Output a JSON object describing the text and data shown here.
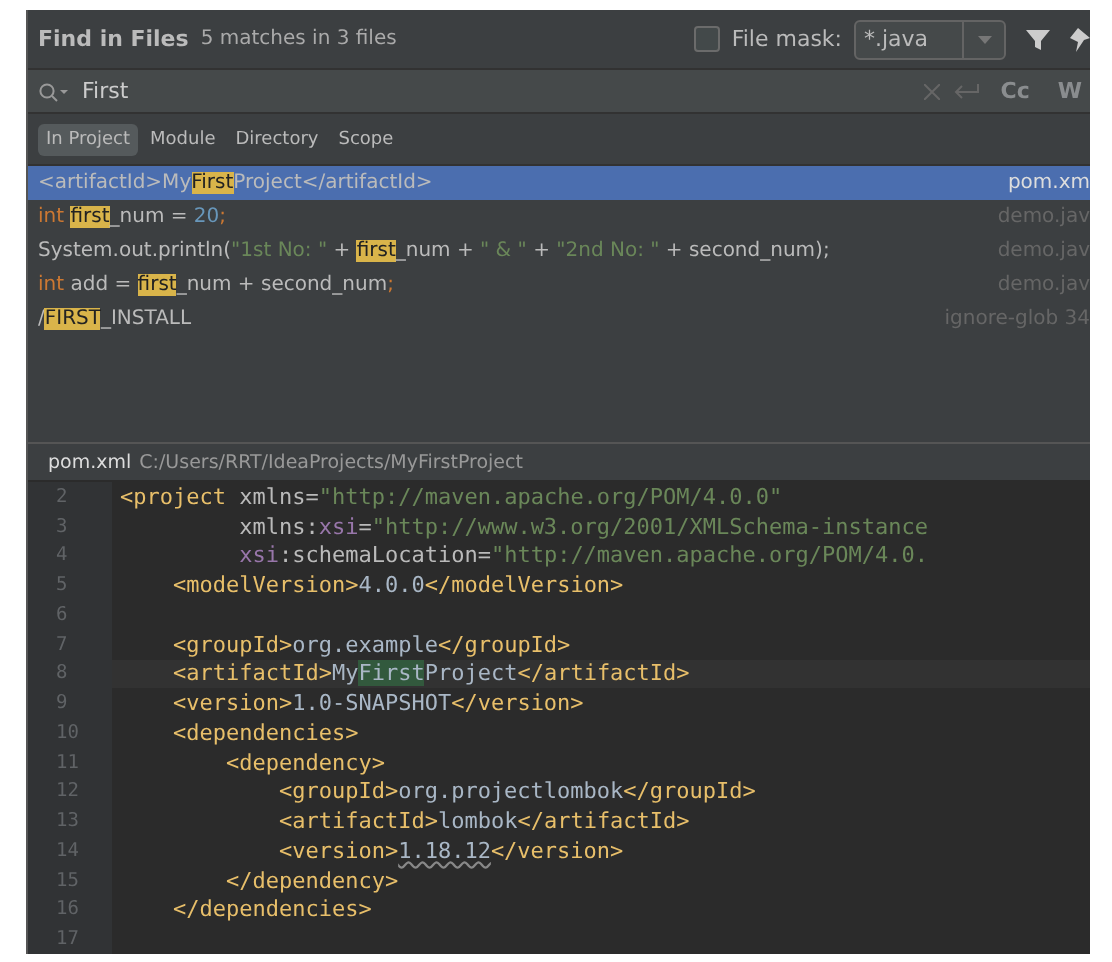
{
  "header": {
    "title": "Find in Files",
    "summary": "5 matches in 3 files",
    "file_mask": {
      "checked": false,
      "label": "File mask:",
      "value": "*.java"
    }
  },
  "search": {
    "value": "First",
    "options": [
      "Cc",
      "W"
    ]
  },
  "scopes": [
    {
      "label": "In Project",
      "selected": true
    },
    {
      "label": "Module",
      "selected": false
    },
    {
      "label": "Directory",
      "selected": false
    },
    {
      "label": "Scope",
      "selected": false
    }
  ],
  "results": [
    {
      "selected": true,
      "file": "pom.xm",
      "parts": [
        {
          "kind": "plain",
          "text": "<artifactId>My"
        },
        {
          "kind": "match",
          "text": "First"
        },
        {
          "kind": "plain",
          "text": "Project</artifactId>"
        }
      ]
    },
    {
      "selected": false,
      "file": "demo.jav",
      "parts": [
        {
          "kind": "keyword",
          "text": "int "
        },
        {
          "kind": "match",
          "text": "first"
        },
        {
          "kind": "plain",
          "text": "_num = "
        },
        {
          "kind": "number",
          "text": "20"
        },
        {
          "kind": "keyword",
          "text": ";"
        }
      ]
    },
    {
      "selected": false,
      "file": "demo.jav",
      "parts": [
        {
          "kind": "plain",
          "text": "System.out.println("
        },
        {
          "kind": "string",
          "text": "\"1st No: \""
        },
        {
          "kind": "plain",
          "text": " + "
        },
        {
          "kind": "match",
          "text": "first"
        },
        {
          "kind": "plain",
          "text": "_num + "
        },
        {
          "kind": "string",
          "text": "\" & \""
        },
        {
          "kind": "plain",
          "text": " + "
        },
        {
          "kind": "string",
          "text": "\"2nd No: \""
        },
        {
          "kind": "plain",
          "text": " + second_num);"
        }
      ]
    },
    {
      "selected": false,
      "file": "demo.jav",
      "parts": [
        {
          "kind": "keyword",
          "text": "int "
        },
        {
          "kind": "plain",
          "text": "add = "
        },
        {
          "kind": "match",
          "text": "first"
        },
        {
          "kind": "plain",
          "text": "_num + second_num"
        },
        {
          "kind": "keyword",
          "text": ";"
        }
      ]
    },
    {
      "selected": false,
      "file": "ignore-glob 34",
      "parts": [
        {
          "kind": "plain",
          "text": "/"
        },
        {
          "kind": "match",
          "text": "FIRST"
        },
        {
          "kind": "plain",
          "text": "_INSTALL"
        }
      ]
    }
  ],
  "preview": {
    "file": "pom.xml",
    "path": "C:/Users/RRT/IdeaProjects/MyFirstProject",
    "lines": [
      {
        "number": "2",
        "parts": [
          {
            "kind": "tag",
            "text": "<project "
          },
          {
            "kind": "attr",
            "text": "xmlns="
          },
          {
            "kind": "string",
            "text": "\"http://maven.apache.org/POM/4.0.0\""
          }
        ]
      },
      {
        "number": "3",
        "parts": [
          {
            "kind": "attr",
            "text": "         xmlns:"
          },
          {
            "kind": "ns",
            "text": "xsi"
          },
          {
            "kind": "attr",
            "text": "="
          },
          {
            "kind": "string",
            "text": "\"http://www.w3.org/2001/XMLSchema-instance"
          }
        ]
      },
      {
        "number": "4",
        "parts": [
          {
            "kind": "ns",
            "text": "         xsi"
          },
          {
            "kind": "attr",
            "text": ":schemaLocation="
          },
          {
            "kind": "string",
            "text": "\"http://maven.apache.org/POM/4.0."
          }
        ]
      },
      {
        "number": "5",
        "parts": [
          {
            "kind": "tag",
            "text": "    <modelVersion>"
          },
          {
            "kind": "text",
            "text": "4.0.0"
          },
          {
            "kind": "tag",
            "text": "</modelVersion>"
          }
        ]
      },
      {
        "number": "6"
      },
      {
        "number": "7",
        "parts": [
          {
            "kind": "tag",
            "text": "    <groupId>"
          },
          {
            "kind": "text",
            "text": "org.example"
          },
          {
            "kind": "tag",
            "text": "</groupId>"
          }
        ]
      },
      {
        "number": "8",
        "current": true,
        "parts": [
          {
            "kind": "tag",
            "text": "    <artifactId>"
          },
          {
            "kind": "text",
            "text": "My"
          },
          {
            "kind": "match",
            "text": "First"
          },
          {
            "kind": "text",
            "text": "Project"
          },
          {
            "kind": "tag",
            "text": "</artifactId>"
          }
        ]
      },
      {
        "number": "9",
        "parts": [
          {
            "kind": "tag",
            "text": "    <version>"
          },
          {
            "kind": "text",
            "text": "1.0-SNAPSHOT"
          },
          {
            "kind": "tag",
            "text": "</version>"
          }
        ]
      },
      {
        "number": "10",
        "parts": [
          {
            "kind": "tag",
            "text": "    <dependencies>"
          }
        ]
      },
      {
        "number": "11",
        "parts": [
          {
            "kind": "tag",
            "text": "        <dependency>"
          }
        ]
      },
      {
        "number": "12",
        "parts": [
          {
            "kind": "tag",
            "text": "            <groupId>"
          },
          {
            "kind": "text",
            "text": "org.projectlombok"
          },
          {
            "kind": "tag",
            "text": "</groupId>"
          }
        ]
      },
      {
        "number": "13",
        "parts": [
          {
            "kind": "tag",
            "text": "            <artifactId>"
          },
          {
            "kind": "text",
            "text": "lombok"
          },
          {
            "kind": "tag",
            "text": "</artifactId>"
          }
        ]
      },
      {
        "number": "14",
        "parts": [
          {
            "kind": "tag",
            "text": "            <version>"
          },
          {
            "kind": "warn",
            "text": "1.18.12"
          },
          {
            "kind": "tag",
            "text": "</version>"
          }
        ]
      },
      {
        "number": "15",
        "parts": [
          {
            "kind": "tag",
            "text": "        </dependency>"
          }
        ]
      },
      {
        "number": "16",
        "parts": [
          {
            "kind": "tag",
            "text": "    </dependencies>"
          }
        ]
      },
      {
        "number": "17"
      }
    ]
  }
}
